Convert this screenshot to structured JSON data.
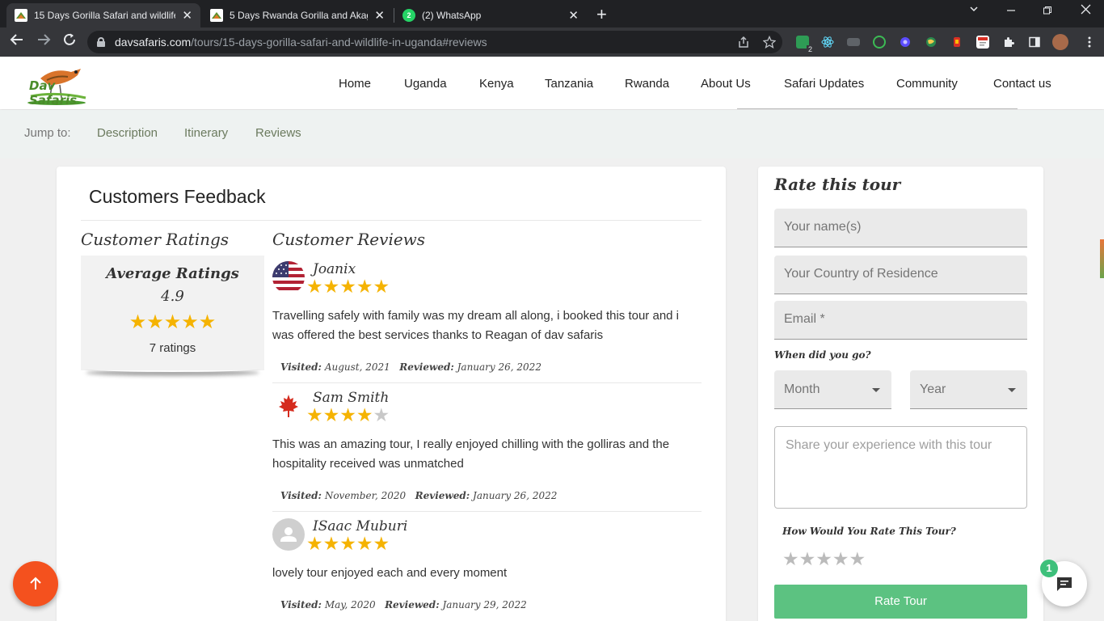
{
  "browser": {
    "tabs": [
      {
        "title": "15 Days Gorilla Safari and wildlife",
        "active": true
      },
      {
        "title": "5 Days Rwanda Gorilla and Akagera",
        "active": false
      },
      {
        "title": "(2) WhatsApp",
        "active": false
      }
    ],
    "url_domain": "davsafaris.com",
    "url_path": "/tours/15-days-gorilla-safari-and-wildlife-in-uganda#reviews",
    "extension_badge": "2"
  },
  "site": {
    "logo_text": "Dav Safaris",
    "nav": [
      "Home",
      "Uganda",
      "Kenya",
      "Tanzania",
      "Rwanda",
      "About Us",
      "Safari Updates",
      "Community",
      "Contact us"
    ],
    "jump_label": "Jump to:",
    "jump_links": [
      "Description",
      "Itinerary",
      "Reviews"
    ]
  },
  "feedback": {
    "title": "Customers Feedback",
    "ratings_heading": "Customer Ratings",
    "reviews_heading": "Customer Reviews",
    "average": {
      "label": "Average Ratings",
      "value": "4.9",
      "stars": 5,
      "count_text": "7 ratings"
    },
    "reviews": [
      {
        "name": "Joanix",
        "flag": "usa-flag",
        "stars": 5,
        "text": "Travelling safely with family was my dream all along, i booked this tour and i was offered the best services thanks to Reagan of dav safaris",
        "visited_label": "Visited:",
        "visited": "August, 2021",
        "reviewed_label": "Reviewed:",
        "reviewed": "January 26, 2022"
      },
      {
        "name": "Sam Smith",
        "flag": "canada-flag",
        "stars": 4,
        "text": "This was an amazing tour, I really enjoyed chilling with the golliras and the hospitality received was unmatched",
        "visited_label": "Visited:",
        "visited": "November, 2020",
        "reviewed_label": "Reviewed:",
        "reviewed": "January 26, 2022"
      },
      {
        "name": "ISaac Muburi",
        "flag": "user-avatar",
        "stars": 5,
        "text": "lovely tour enjoyed each and every moment",
        "visited_label": "Visited:",
        "visited": "May, 2020",
        "reviewed_label": "Reviewed:",
        "reviewed": "January 29, 2022"
      }
    ]
  },
  "rate_form": {
    "title": "Rate this tour",
    "name_placeholder": "Your name(s)",
    "country_placeholder": "Your Country of Residence",
    "email_placeholder": "Email *",
    "when_label": "When did you go?",
    "month_placeholder": "Month",
    "year_placeholder": "Year",
    "experience_placeholder": "Share your experience with this tour",
    "how_rate_label": "How Would You Rate This Tour?",
    "submit_label": "Rate Tour"
  },
  "chat": {
    "badge": "1"
  },
  "colors": {
    "star": "#f5b301",
    "submit": "#5cc281",
    "fab": "#f4511e"
  },
  "glyphs": {
    "star": "★",
    "tab_close": "✕",
    "new_tab": "+"
  }
}
